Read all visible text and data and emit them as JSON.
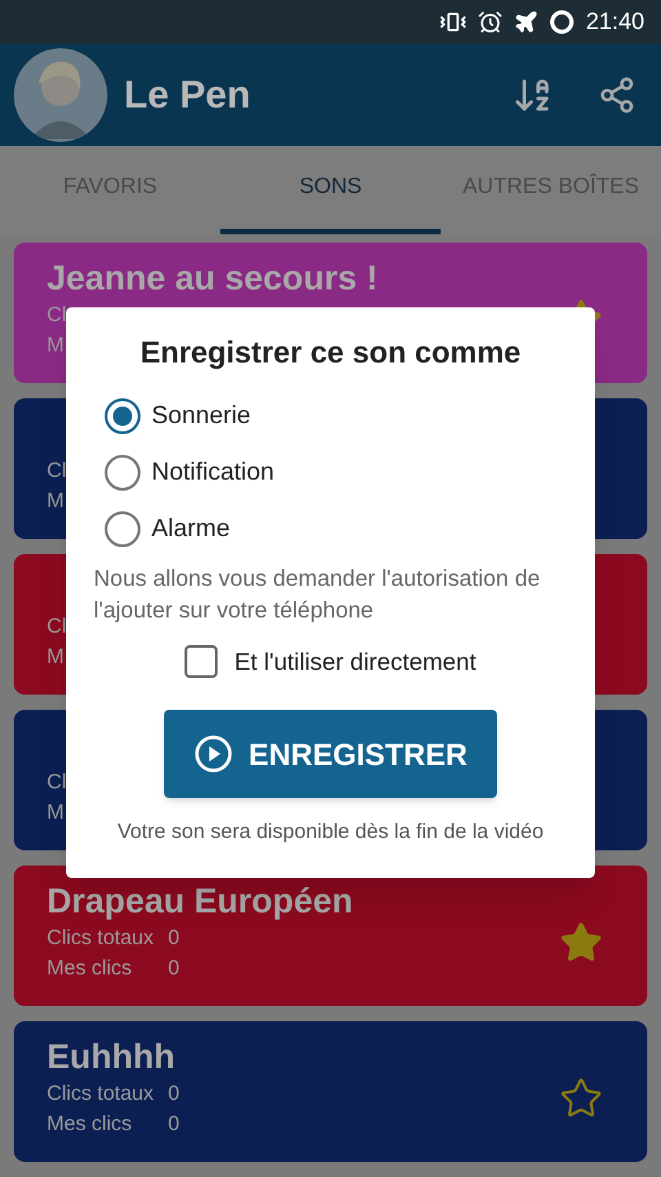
{
  "status_bar": {
    "time": "21:40"
  },
  "app_bar": {
    "title": "Le Pen"
  },
  "tabs": [
    {
      "label": "FAVORIS",
      "selected": false
    },
    {
      "label": "SONS",
      "selected": true
    },
    {
      "label": "AUTRES BOÎTES",
      "selected": false
    }
  ],
  "sounds": [
    {
      "title": "Jeanne au secours !",
      "color": "#8a2a84",
      "total_label": "Cl",
      "mine_label": "M",
      "favorite": true
    },
    {
      "color": "#0b1f52",
      "total_label": "Cl",
      "mine_label": "M"
    },
    {
      "color": "#8c0a1f",
      "total_label": "Cl",
      "mine_label": "M"
    },
    {
      "color": "#0b1f52",
      "total_label": "Cl",
      "mine_label": "M"
    },
    {
      "title": "Drapeau Européen",
      "color": "#8c0a1f",
      "total_label": "Clics totaux",
      "total": "0",
      "mine_label": "Mes clics",
      "mine": "0",
      "favorite": true
    },
    {
      "title": "Euhhhh",
      "color": "#0b1f52",
      "total_label": "Clics totaux",
      "total": "0",
      "mine_label": "Mes clics",
      "mine": "0",
      "favorite": false
    }
  ],
  "dialog": {
    "title": "Enregistrer ce son comme",
    "options": [
      {
        "label": "Sonnerie",
        "selected": true
      },
      {
        "label": "Notification",
        "selected": false
      },
      {
        "label": "Alarme",
        "selected": false
      }
    ],
    "message": "Nous allons vous demander l'autorisation de l'ajouter sur votre téléphone",
    "checkbox": {
      "label": "Et l'utiliser directement",
      "checked": false
    },
    "button": "ENREGISTRER",
    "footer": "Votre son sera disponible dès la fin de la vidéo"
  }
}
